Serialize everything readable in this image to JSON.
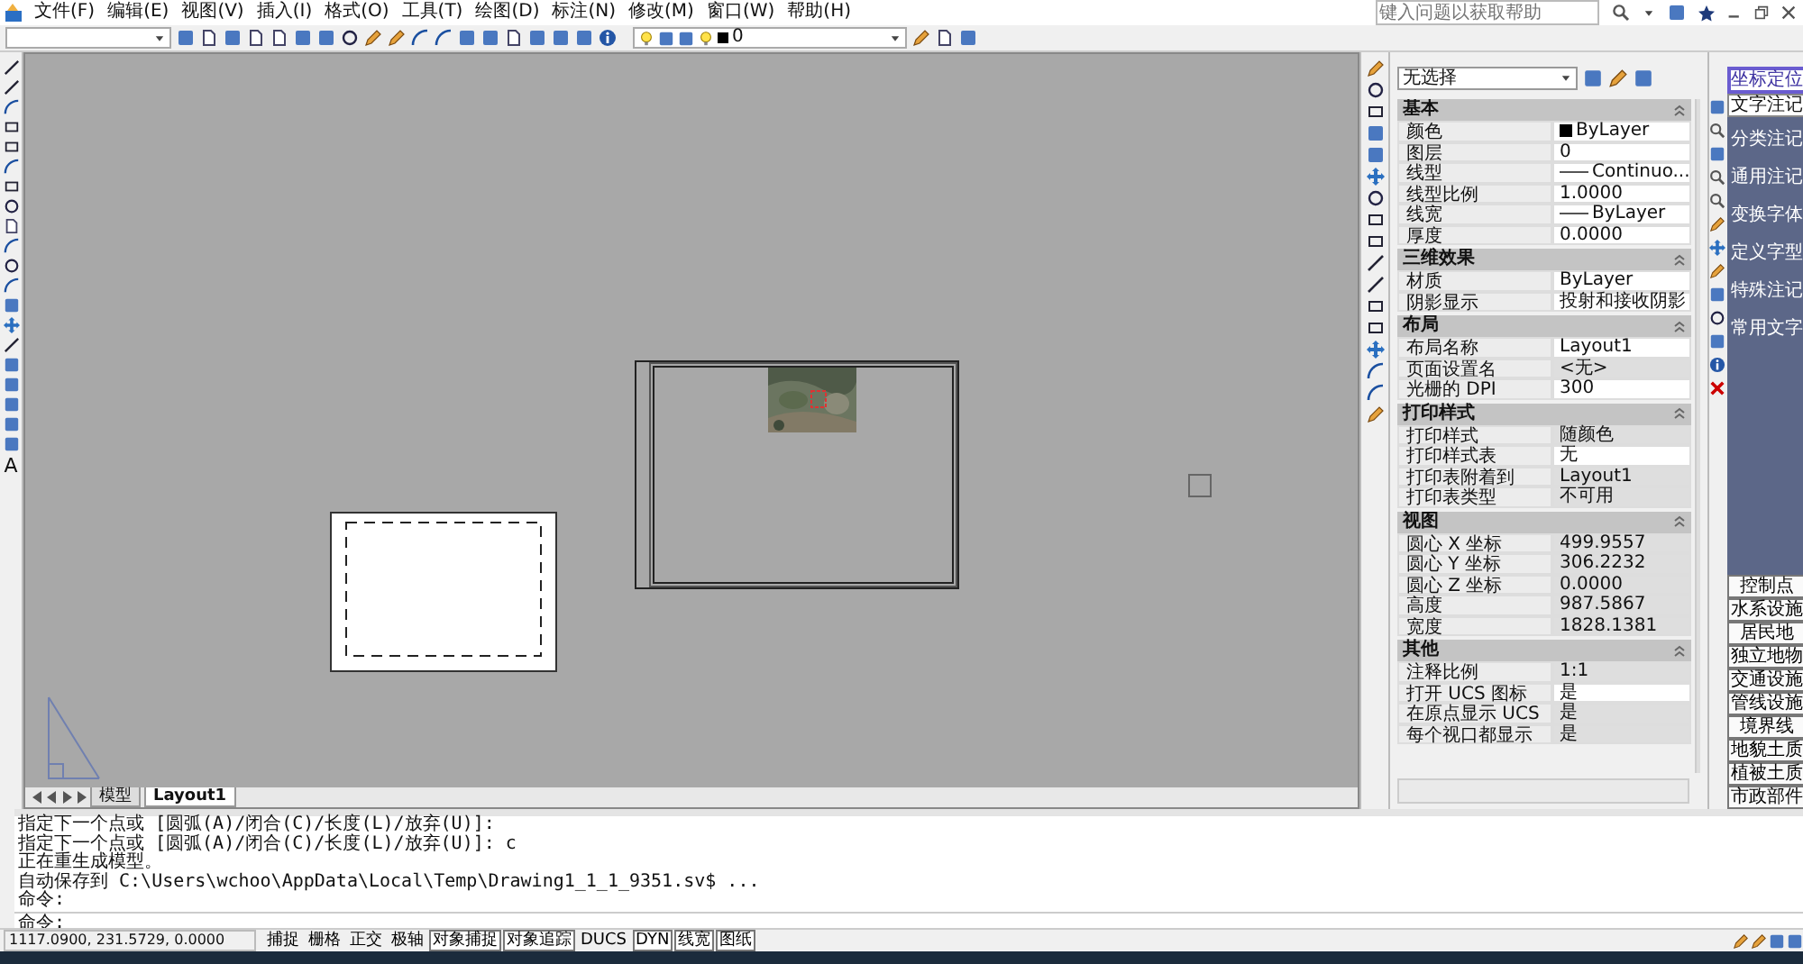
{
  "menu": [
    "文件(F)",
    "编辑(E)",
    "视图(V)",
    "插入(I)",
    "格式(O)",
    "工具(T)",
    "绘图(D)",
    "标注(N)",
    "修改(M)",
    "窗口(W)",
    "帮助(H)"
  ],
  "help_search": {
    "placeholder": "键入问题以获取帮助"
  },
  "toolbar": {
    "layer": "0"
  },
  "left_toolbar": {
    "text_tool": "A"
  },
  "canvas": {
    "layout_tabs": [
      {
        "label": "模型",
        "selected": false
      },
      {
        "label": "Layout1",
        "selected": true
      }
    ]
  },
  "properties": {
    "selection": "无选择",
    "sections": [
      {
        "title": "基本",
        "rows": [
          {
            "label": "颜色",
            "value": "ByLayer",
            "kind": "color",
            "color": "#000000",
            "readonly": false
          },
          {
            "label": "图层",
            "value": "0",
            "kind": "text",
            "readonly": false
          },
          {
            "label": "线型",
            "value": "Continuo...",
            "kind": "linetype",
            "readonly": false
          },
          {
            "label": "线型比例",
            "value": "1.0000",
            "kind": "text",
            "readonly": false
          },
          {
            "label": "线宽",
            "value": "ByLayer",
            "kind": "linetype",
            "readonly": false
          },
          {
            "label": "厚度",
            "value": "0.0000",
            "kind": "text",
            "readonly": false
          }
        ]
      },
      {
        "title": "三维效果",
        "rows": [
          {
            "label": "材质",
            "value": "ByLayer",
            "kind": "text",
            "readonly": false
          },
          {
            "label": "阴影显示",
            "value": "投射和接收阴影",
            "kind": "text",
            "readonly": false
          }
        ]
      },
      {
        "title": "布局",
        "rows": [
          {
            "label": "布局名称",
            "value": "Layout1",
            "kind": "text",
            "readonly": false
          },
          {
            "label": "页面设置名",
            "value": "<无>",
            "kind": "text",
            "readonly": true
          },
          {
            "label": "光栅的 DPI",
            "value": "300",
            "kind": "text",
            "readonly": false
          }
        ]
      },
      {
        "title": "打印样式",
        "rows": [
          {
            "label": "打印样式",
            "value": "随颜色",
            "kind": "text",
            "readonly": true
          },
          {
            "label": "打印样式表",
            "value": "无",
            "kind": "text",
            "readonly": false
          },
          {
            "label": "打印表附着到",
            "value": "Layout1",
            "kind": "text",
            "readonly": true
          },
          {
            "label": "打印表类型",
            "value": "不可用",
            "kind": "text",
            "readonly": true
          }
        ]
      },
      {
        "title": "视图",
        "rows": [
          {
            "label": "圆心 X 坐标",
            "value": "499.9557",
            "kind": "text",
            "readonly": true
          },
          {
            "label": "圆心 Y 坐标",
            "value": "306.2232",
            "kind": "text",
            "readonly": true
          },
          {
            "label": "圆心 Z 坐标",
            "value": "0.0000",
            "kind": "text",
            "readonly": true
          },
          {
            "label": "高度",
            "value": "987.5867",
            "kind": "text",
            "readonly": true
          },
          {
            "label": "宽度",
            "value": "1828.1381",
            "kind": "text",
            "readonly": true
          }
        ]
      },
      {
        "title": "其他",
        "rows": [
          {
            "label": "注释比例",
            "value": "1:1",
            "kind": "text",
            "readonly": true
          },
          {
            "label": "打开 UCS 图标",
            "value": "是",
            "kind": "text",
            "readonly": false
          },
          {
            "label": "在原点显示 UCS",
            "value": "是",
            "kind": "text",
            "readonly": true
          },
          {
            "label": "每个视口都显示",
            "value": "是",
            "kind": "text",
            "readonly": true
          }
        ]
      }
    ]
  },
  "palette": {
    "tabs": [
      {
        "label": "坐标定位",
        "selected": true
      },
      {
        "label": "文字注记",
        "selected": false
      }
    ],
    "items": [
      "分类注记",
      "通用注记",
      "变换字体",
      "定义字型",
      "特殊注记",
      "常用文字"
    ],
    "buttons": [
      "控制点",
      "水系设施",
      "居民地",
      "独立地物",
      "交通设施",
      "管线设施",
      "境界线",
      "地貌土质",
      "植被土质",
      "市政部件"
    ]
  },
  "command": {
    "history": [
      "指定下一个点或 [圆弧(A)/闭合(C)/长度(L)/放弃(U)]:",
      "指定下一个点或 [圆弧(A)/闭合(C)/长度(L)/放弃(U)]: c",
      "正在重生成模型。",
      "自动保存到 C:\\Users\\wchoo\\AppData\\Local\\Temp\\Drawing1_1_1_9351.sv$ ...",
      "命令:"
    ],
    "prompt": "命令:"
  },
  "status_bar": {
    "coordinates": "1117.0900, 231.5729, 0.0000",
    "toggles": [
      {
        "label": "捕捉",
        "on": false
      },
      {
        "label": "栅格",
        "on": false
      },
      {
        "label": "正交",
        "on": false
      },
      {
        "label": "极轴",
        "on": false
      },
      {
        "label": "对象捕捉",
        "on": true
      },
      {
        "label": "对象追踪",
        "on": true
      },
      {
        "label": "DUCS",
        "on": false
      },
      {
        "label": "DYN",
        "on": true
      },
      {
        "label": "线宽",
        "on": true
      },
      {
        "label": "图纸",
        "on": true
      }
    ]
  }
}
